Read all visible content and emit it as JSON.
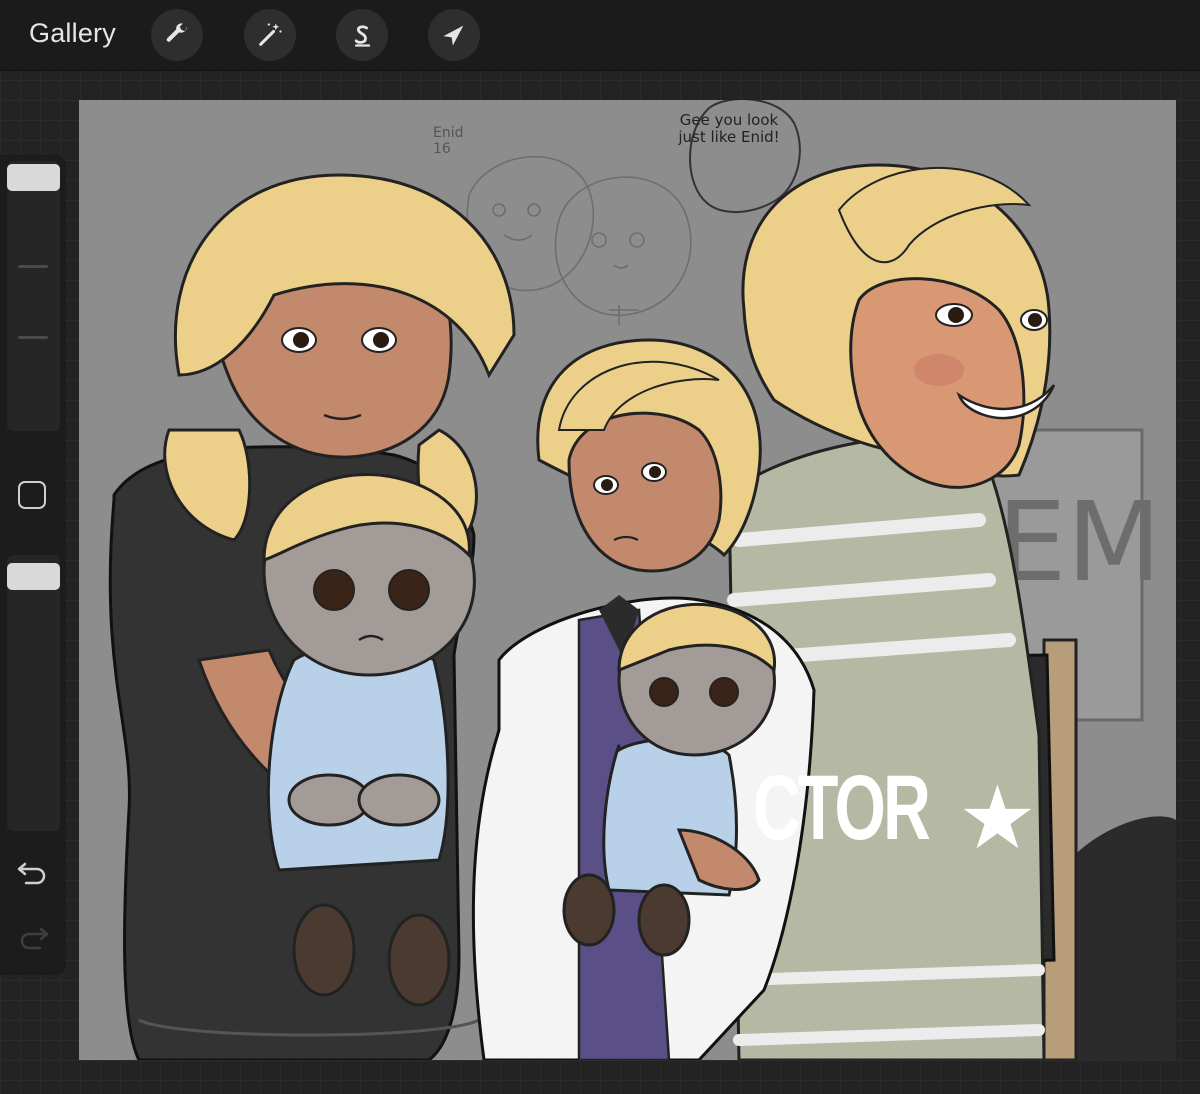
{
  "topbar": {
    "gallery_label": "Gallery",
    "tools": [
      {
        "name": "actions",
        "icon": "wrench-icon"
      },
      {
        "name": "adjustments",
        "icon": "magic-wand-icon"
      },
      {
        "name": "selection",
        "icon": "selection-s-icon"
      },
      {
        "name": "transform",
        "icon": "arrow-cursor-icon"
      }
    ]
  },
  "sidebar": {
    "brush_size_level": 0.05,
    "opacity_level": 0.05,
    "modify_icon": "square-icon",
    "undo_icon": "undo-icon",
    "redo_icon": "redo-icon"
  },
  "canvas": {
    "sketch_note": "Enid\n16",
    "speech_bubble": "Gee you look just like Enid!",
    "chair_back_text": "CTOR",
    "chair_star": "★",
    "wall_sign_text": "EM"
  },
  "colors": {
    "canvas_bg": "#8d8d8d",
    "hair": "#ecd08a",
    "dress_dark": "#333333",
    "blazer_white": "#f4f4f4",
    "uniform_purple": "#5a4f86",
    "doll_dress": "#b9d1e8",
    "stripes_sage": "#b5b8a2",
    "chair_black": "#2b2b2b",
    "chair_wood": "#b79d79"
  }
}
